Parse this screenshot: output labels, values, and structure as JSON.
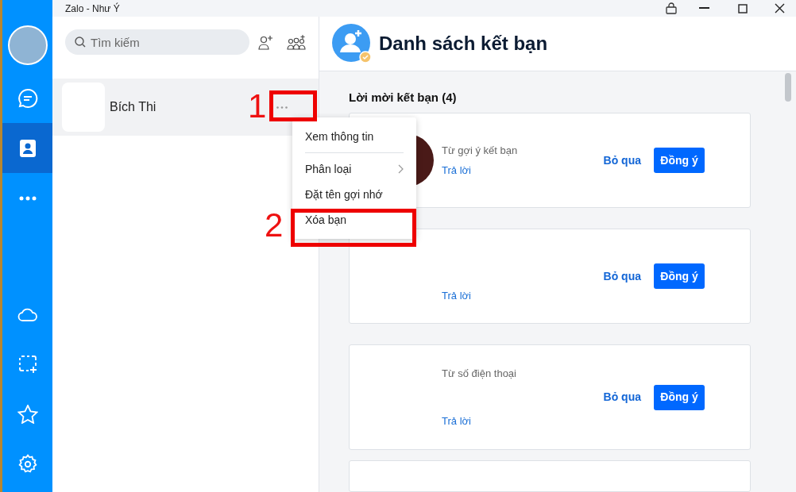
{
  "window": {
    "title": "Zalo - Như Ý"
  },
  "nav": {
    "top": [
      {
        "kind": "chat",
        "selected": false
      },
      {
        "kind": "contacts",
        "selected": true
      },
      {
        "kind": "more",
        "selected": false
      }
    ],
    "bottom": [
      {
        "kind": "cloud"
      },
      {
        "kind": "capture"
      },
      {
        "kind": "star"
      },
      {
        "kind": "settings"
      }
    ]
  },
  "search": {
    "placeholder": "Tìm kiếm"
  },
  "contacts": [
    {
      "name": "Bích Thi",
      "selected": true
    }
  ],
  "context_menu": [
    {
      "kind": "item",
      "label": "Xem thông tin"
    },
    {
      "kind": "divider"
    },
    {
      "kind": "submenu",
      "label": "Phân loại"
    },
    {
      "kind": "item",
      "label": "Đặt tên gợi nhớ"
    },
    {
      "kind": "item",
      "label": "Xóa bạn"
    }
  ],
  "annotations": [
    {
      "number": "1"
    },
    {
      "number": "2"
    }
  ],
  "header": {
    "title": "Danh sách kết bạn"
  },
  "requests_heading": "Lời mời kết bạn (4)",
  "requests": [
    {
      "source": "Từ gợi ý kết bạn",
      "avatar": true,
      "reply": "Trả lời",
      "skip": "Bỏ qua",
      "accept": "Đồng ý"
    },
    {
      "reply": "Trả lời",
      "skip": "Bỏ qua",
      "accept": "Đồng ý"
    },
    {
      "source": "Từ số điện thoại",
      "reply": "Trả lời",
      "skip": "Bỏ qua",
      "accept": "Đồng ý"
    }
  ]
}
